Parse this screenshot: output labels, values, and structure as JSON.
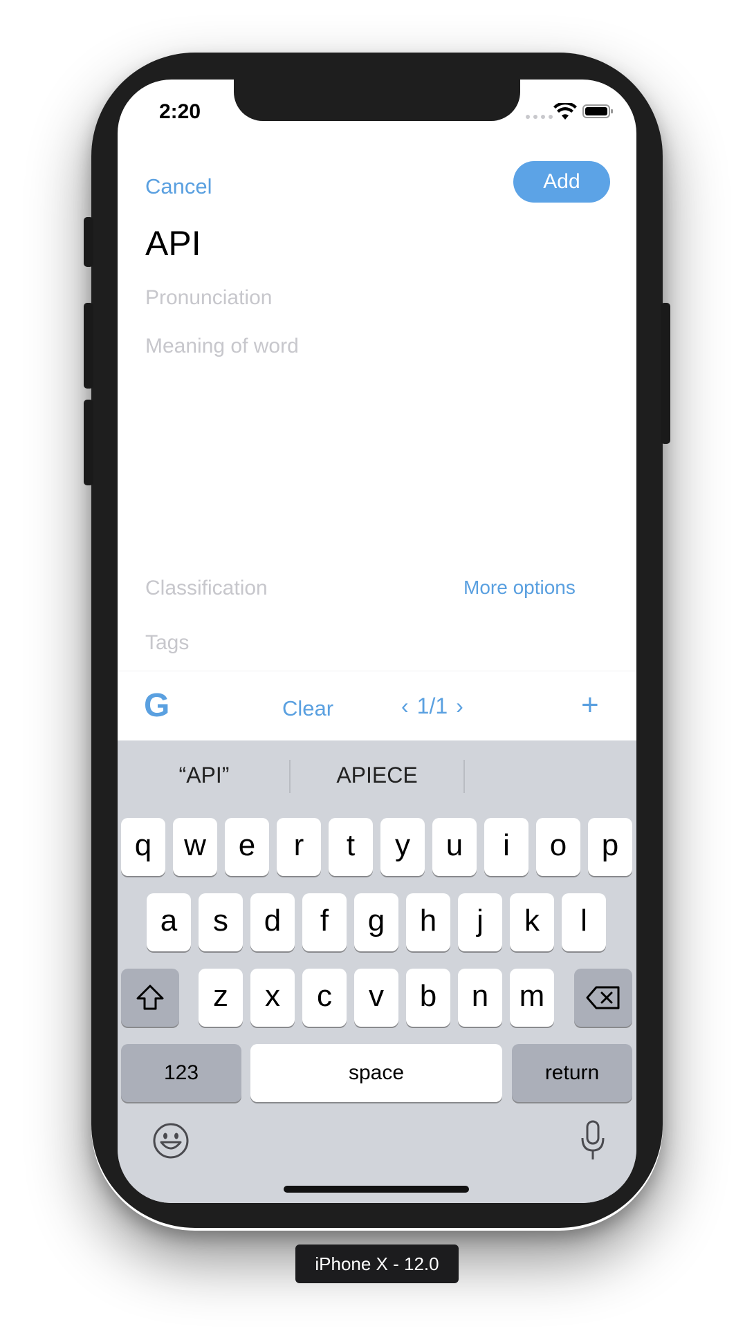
{
  "status_bar": {
    "time": "2:20"
  },
  "form": {
    "cancel_label": "Cancel",
    "add_label": "Add",
    "word_value": "API",
    "pronunciation_placeholder": "Pronunciation",
    "meaning_placeholder": "Meaning of word",
    "classification_placeholder": "Classification",
    "more_options_label": "More options",
    "tags_placeholder": "Tags"
  },
  "accessory_bar": {
    "google_glyph": "G",
    "clear_label": "Clear",
    "page_indicator": "1/1",
    "prev_glyph": "‹",
    "next_glyph": "›",
    "plus_glyph": "+"
  },
  "keyboard": {
    "suggestions": [
      "“API”",
      "APIECE",
      ""
    ],
    "row1": [
      "q",
      "w",
      "e",
      "r",
      "t",
      "y",
      "u",
      "i",
      "o",
      "p"
    ],
    "row2": [
      "a",
      "s",
      "d",
      "f",
      "g",
      "h",
      "j",
      "k",
      "l"
    ],
    "row3": [
      "z",
      "x",
      "c",
      "v",
      "b",
      "n",
      "m"
    ],
    "numbers_label": "123",
    "space_label": "space",
    "return_label": "return",
    "shift_icon": "shift-icon",
    "backspace_icon": "backspace-icon",
    "emoji_icon": "emoji-icon",
    "mic_icon": "microphone-icon"
  },
  "simulator_label": "iPhone X - 12.0",
  "colors": {
    "accent": "#5aa0e0",
    "add_button": "#5ca3e6",
    "placeholder": "#c7c7cc",
    "keyboard_bg": "#d1d4da",
    "key_dark": "#abafb9"
  }
}
